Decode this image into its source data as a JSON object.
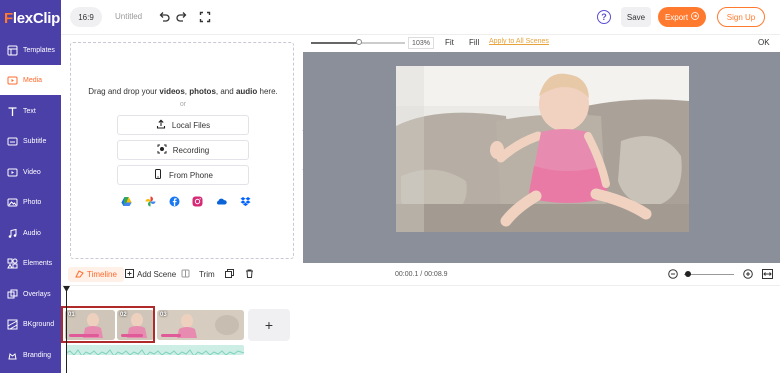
{
  "app": {
    "logo_prefix": "F",
    "logo_rest": "lexClip"
  },
  "sidebar": {
    "items": [
      {
        "label": "Templates",
        "icon": "templates-icon"
      },
      {
        "label": "Media",
        "icon": "media-icon",
        "active": true
      },
      {
        "label": "Text",
        "icon": "text-icon"
      },
      {
        "label": "Subtitle",
        "icon": "subtitle-icon"
      },
      {
        "label": "Video",
        "icon": "video-icon"
      },
      {
        "label": "Photo",
        "icon": "photo-icon"
      },
      {
        "label": "Audio",
        "icon": "audio-icon"
      },
      {
        "label": "Elements",
        "icon": "elements-icon"
      },
      {
        "label": "Overlays",
        "icon": "overlays-icon"
      },
      {
        "label": "BKground",
        "icon": "background-icon"
      },
      {
        "label": "Branding",
        "icon": "branding-icon"
      }
    ]
  },
  "topbar": {
    "ratio": "16:9",
    "title": "Untitled",
    "help": "?",
    "save": "Save",
    "export": "Export",
    "signup": "Sign Up"
  },
  "media": {
    "drop_prefix": "Drag and drop your",
    "drop_videos": "videos",
    "drop_comma1": ",",
    "drop_photos": "photos",
    "drop_comma2": ", and",
    "drop_audio": "audio",
    "drop_suffix": "here.",
    "or": "or",
    "local_files": "Local Files",
    "recording": "Recording",
    "from_phone": "From Phone",
    "cloud_sources": [
      "google-drive-icon",
      "google-photos-icon",
      "facebook-icon",
      "instagram-icon",
      "onedrive-icon",
      "dropbox-icon"
    ]
  },
  "preview": {
    "zoom": "103%",
    "fit": "Fit",
    "fill": "Fill",
    "apply_all": "Apply to All Scenes",
    "ok": "OK"
  },
  "timeline": {
    "tab": "Timeline",
    "add_scene": "Add Scene",
    "trim": "Trim",
    "time": "00:00.1 / 00:08.9",
    "clips": [
      {
        "number": "01"
      },
      {
        "number": "02"
      },
      {
        "number": "03"
      }
    ],
    "add": "+"
  },
  "colors": {
    "sidebar": "#4b3fa8",
    "accent": "#ff7a2f",
    "preview_bg": "#8b8f99"
  }
}
